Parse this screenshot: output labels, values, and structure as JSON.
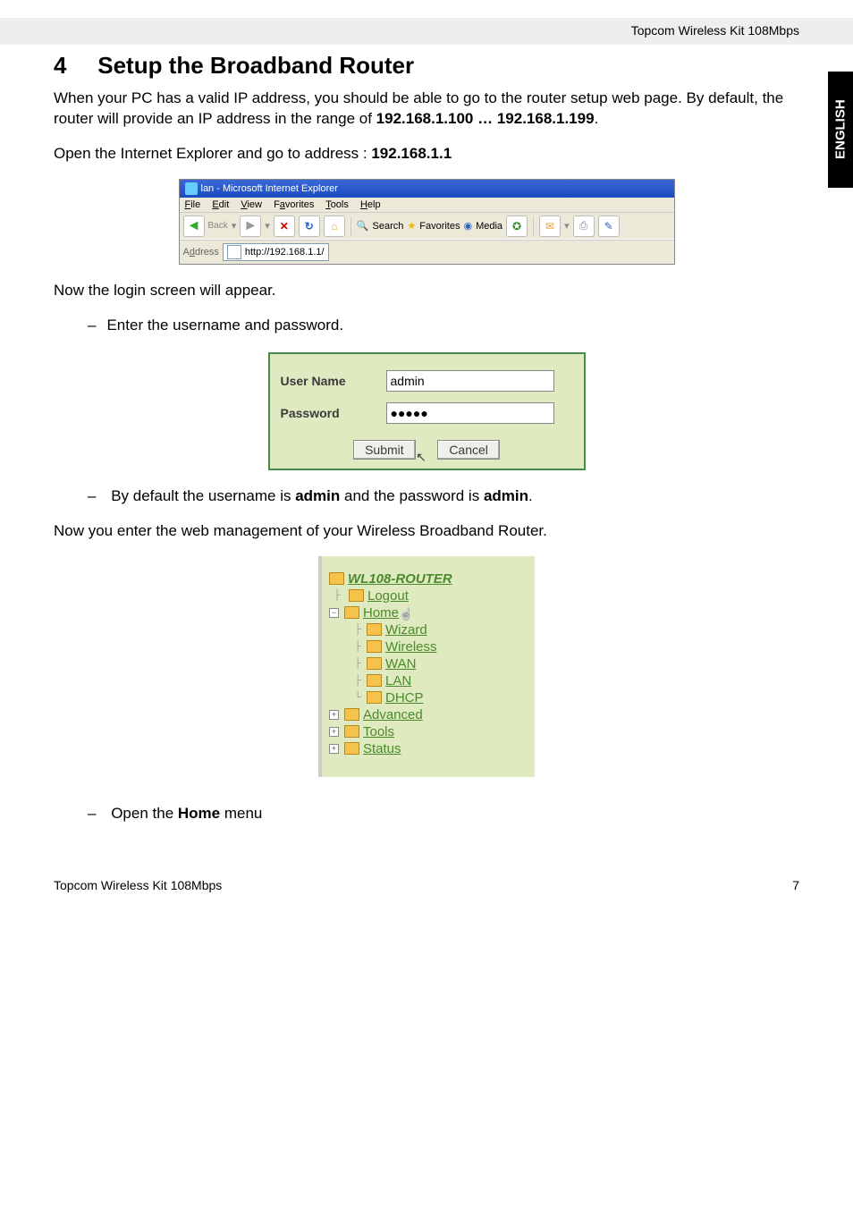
{
  "header_product": "Topcom Wireless Kit 108Mbps",
  "side_tab": "ENGLISH",
  "section": {
    "number": "4",
    "title": "Setup the Broadband Router"
  },
  "intro": {
    "p1_a": "When your PC has a valid IP address, you should be able to go to the router setup web page. By default, the router will provide an IP address in the range of ",
    "p1_b": "192.168.1.100 … 192.168.1.199",
    "p1_c": ".",
    "p2_a": "Open the Internet Explorer and go to address : ",
    "p2_b": "192.168.1.1"
  },
  "ie": {
    "title": "lan - Microsoft Internet Explorer",
    "menu": {
      "file": "File",
      "edit": "Edit",
      "view": "View",
      "favorites": "Favorites",
      "tools": "Tools",
      "help": "Help"
    },
    "toolbar": {
      "back": "Back",
      "search": "Search",
      "favorites": "Favorites",
      "media": "Media"
    },
    "address_label": "Address",
    "address_value": "http://192.168.1.1/"
  },
  "after_ie": "Now the login screen will appear.",
  "bullet_enter": "Enter the username and password.",
  "login": {
    "user_label": "User Name",
    "user_value": "admin",
    "pass_label": "Password",
    "pass_value": "●●●●●",
    "submit": "Submit",
    "cancel": "Cancel"
  },
  "bullet_default_a": "By default the username is ",
  "bullet_default_b": "admin",
  "bullet_default_c": " and the password is ",
  "bullet_default_d": "admin",
  "bullet_default_e": ".",
  "after_login": "Now you enter the web management of your Wireless Broadband Router.",
  "tree": {
    "root": "WL108-ROUTER",
    "logout": "Logout",
    "home": "Home",
    "wizard": "Wizard",
    "wireless": "Wireless",
    "wan": "WAN",
    "lan": "LAN",
    "dhcp": "DHCP",
    "advanced": "Advanced",
    "tools": "Tools",
    "status": "Status"
  },
  "bullet_open_a": "Open the ",
  "bullet_open_b": "Home",
  "bullet_open_c": " menu",
  "footer_left": "Topcom Wireless Kit 108Mbps",
  "footer_page": "7"
}
